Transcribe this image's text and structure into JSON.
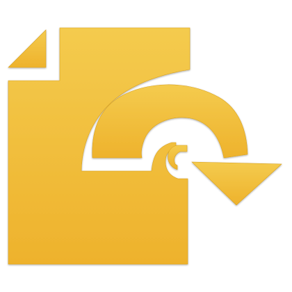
{
  "icon": {
    "name": "document-export-icon",
    "colors": {
      "fill_top": "#F4CB4E",
      "fill_bottom": "#EEB22C",
      "edge": "#D9A21E",
      "background": "#FFFFFF"
    }
  }
}
